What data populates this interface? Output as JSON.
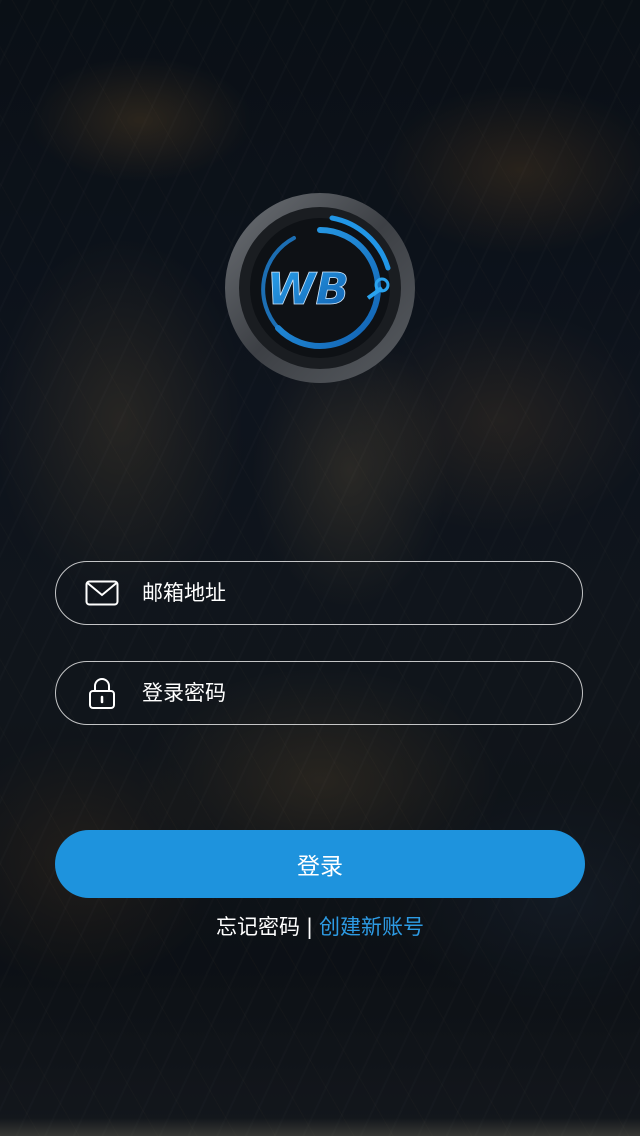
{
  "brand": {
    "logo_text": "WB",
    "accent_color": "#1e93dd"
  },
  "form": {
    "email": {
      "placeholder": "邮箱地址",
      "value": "",
      "icon": "envelope-icon"
    },
    "password": {
      "placeholder": "登录密码",
      "value": "",
      "icon": "lock-icon"
    },
    "login_label": "登录"
  },
  "links": {
    "forgot_password": "忘记密码",
    "separator": "|",
    "create_account": "创建新账号"
  }
}
